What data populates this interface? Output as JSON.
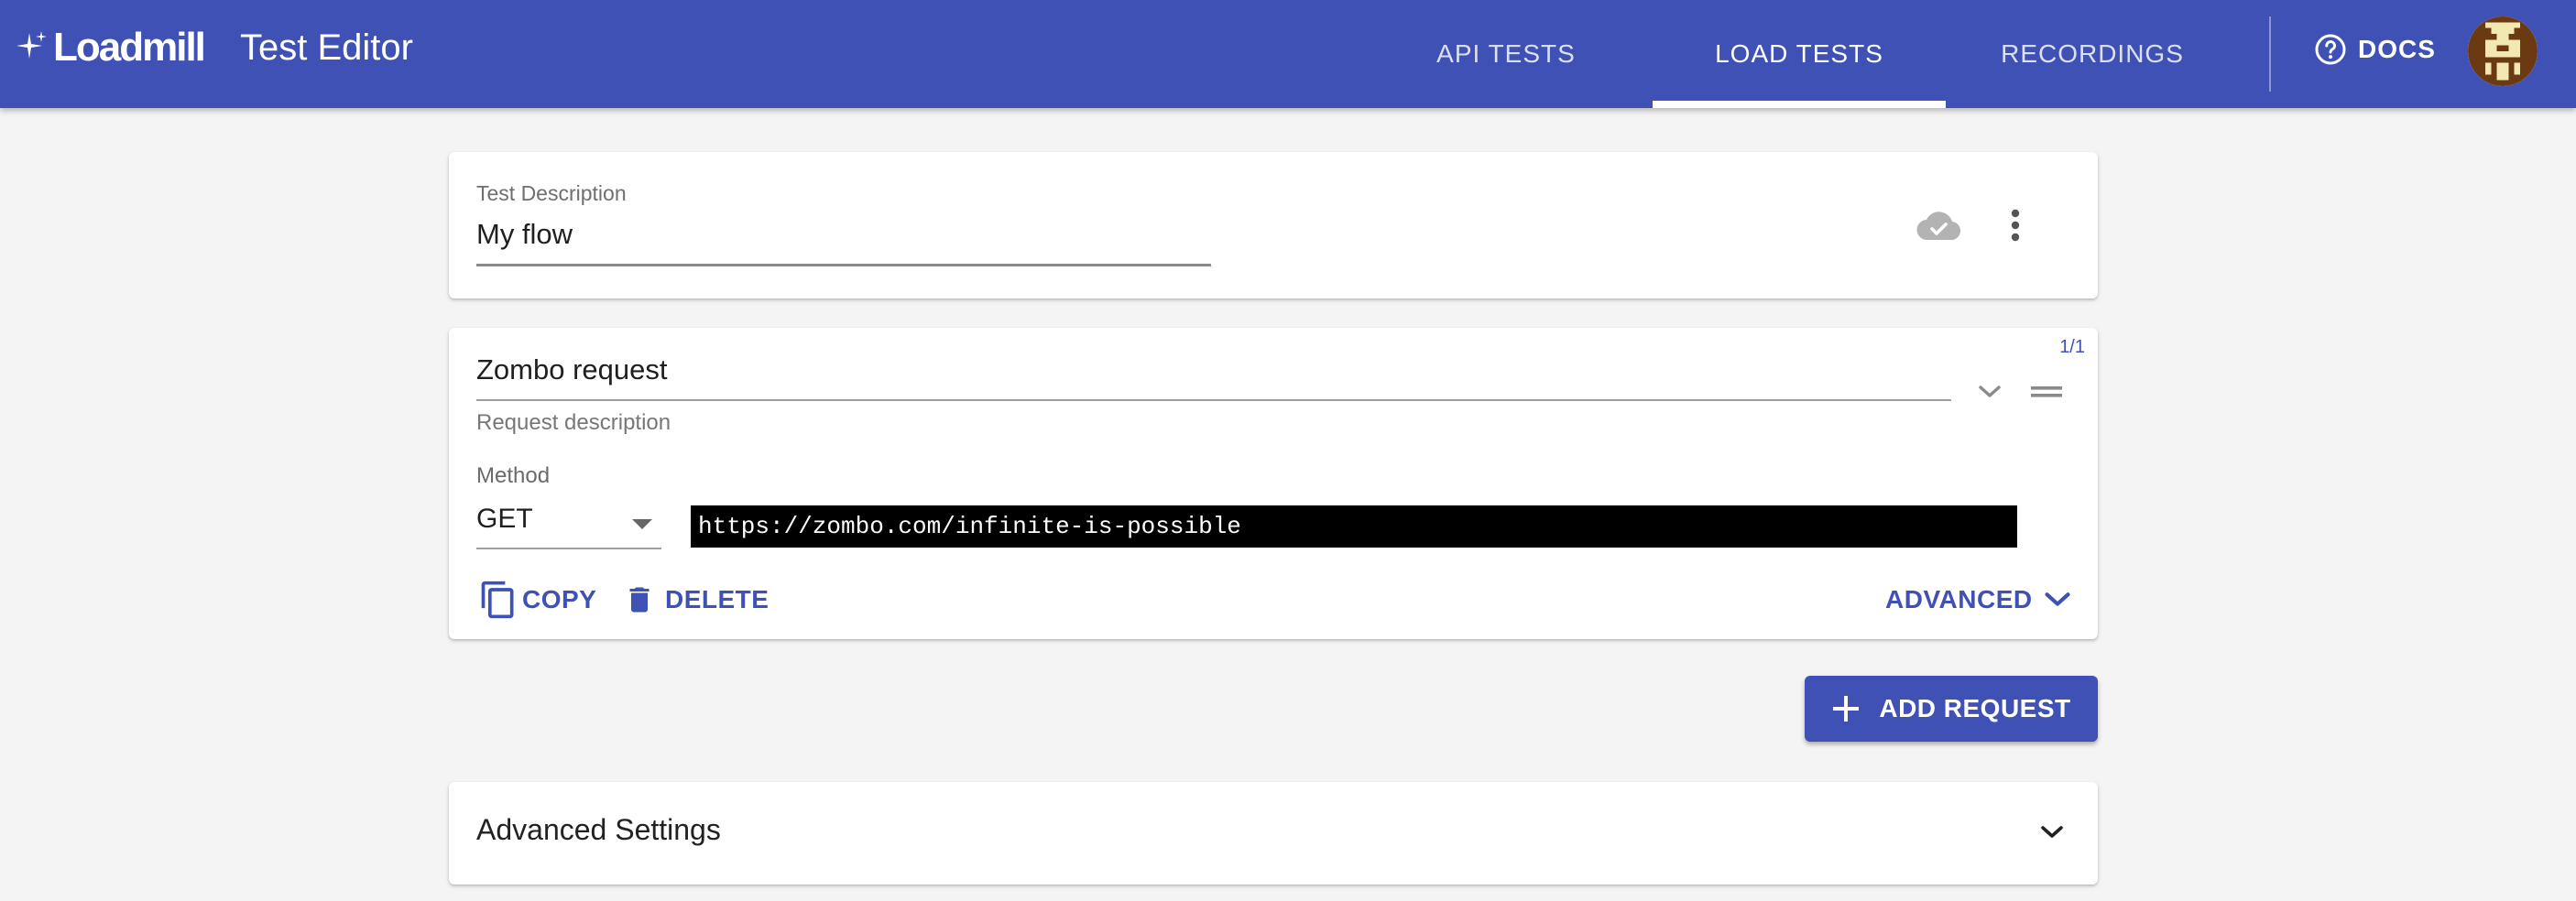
{
  "header": {
    "logo_text": "Loadmill",
    "title": "Test Editor",
    "tabs": [
      {
        "label": "API TESTS",
        "active": false
      },
      {
        "label": "LOAD TESTS",
        "active": true
      },
      {
        "label": "RECORDINGS",
        "active": false
      }
    ],
    "docs_label": "DOCS",
    "accent_color": "#3f51b5"
  },
  "test": {
    "description_label": "Test Description",
    "description_value": "My flow"
  },
  "request": {
    "counter": "1/1",
    "name": "Zombo request",
    "description_placeholder": "Request description",
    "method_label": "Method",
    "method_value": "GET",
    "url": "https://zombo.com/infinite-is-possible",
    "copy_label": "COPY",
    "delete_label": "DELETE",
    "advanced_label": "ADVANCED"
  },
  "add_request_label": "ADD REQUEST",
  "advanced_settings": {
    "title": "Advanced Settings"
  },
  "icons": {
    "cloud": "cloud-check-icon",
    "more": "more-vert-icon",
    "expand": "chevron-down-icon",
    "drag": "drag-handle-icon",
    "copy": "copy-icon",
    "delete": "trash-icon",
    "add": "plus-icon",
    "help": "help-circle-icon"
  }
}
